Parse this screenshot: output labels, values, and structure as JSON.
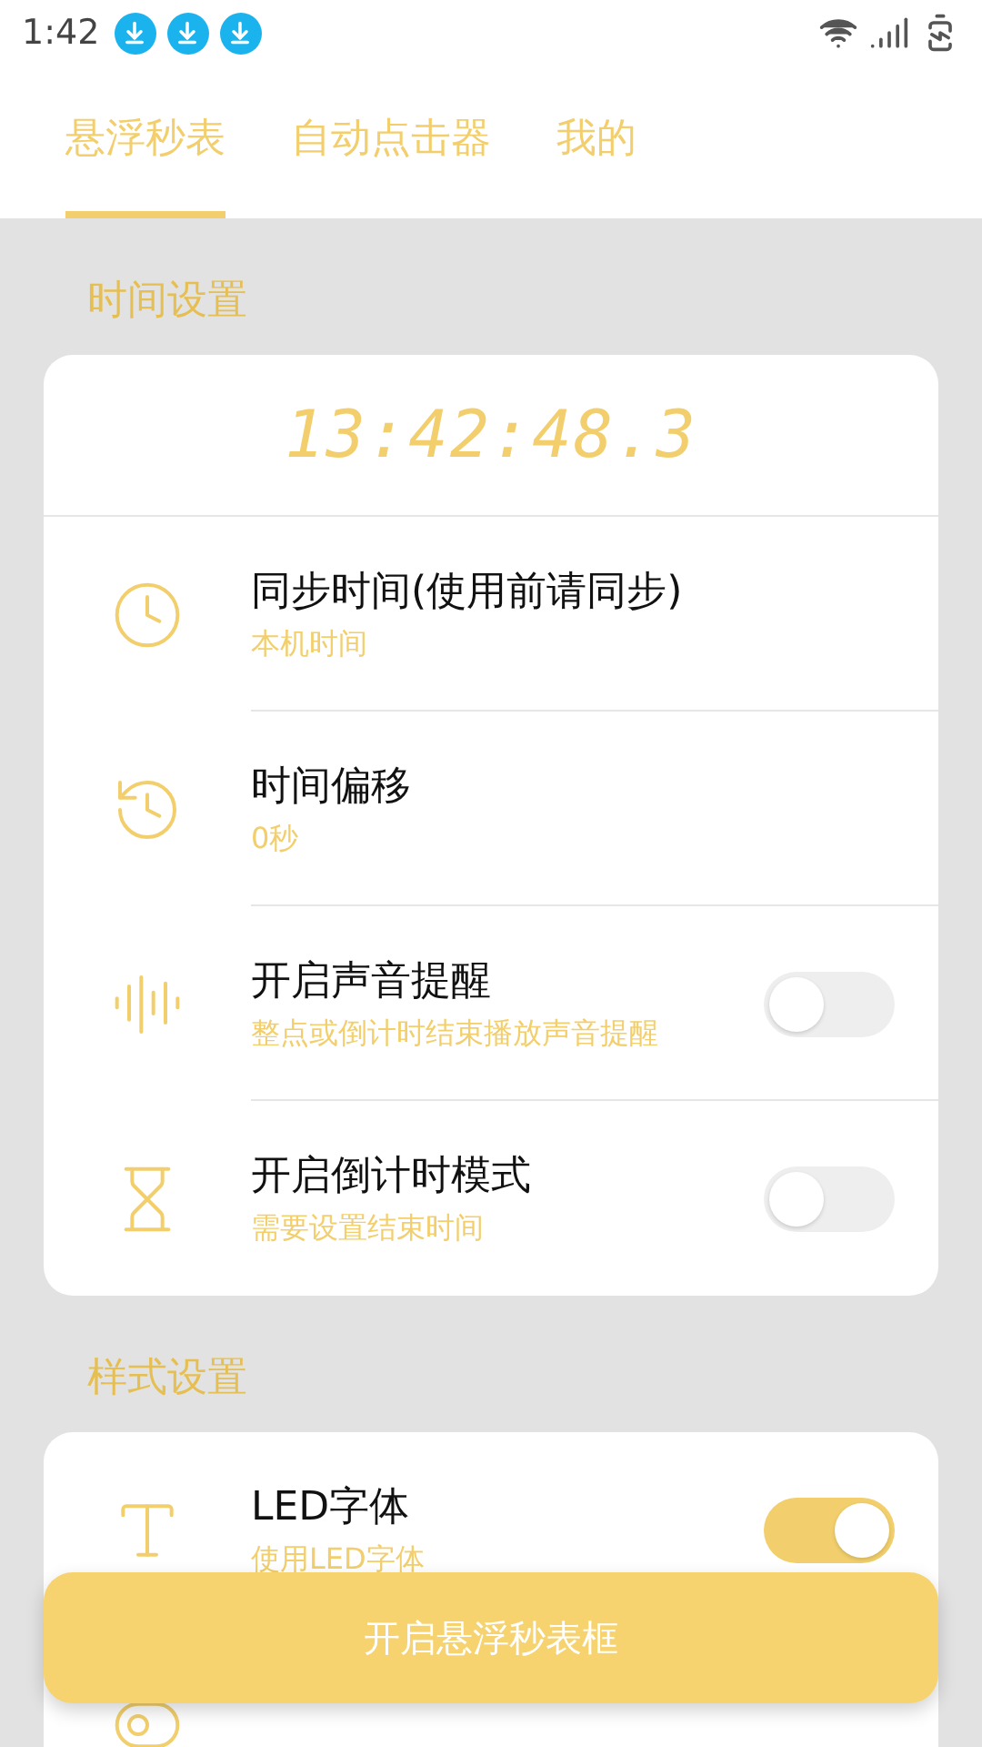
{
  "status_bar": {
    "time": "1:42"
  },
  "tabs": [
    {
      "label": "悬浮秒表",
      "selected": true
    },
    {
      "label": "自动点击器",
      "selected": false
    },
    {
      "label": "我的",
      "selected": false
    }
  ],
  "sections": [
    {
      "title": "时间设置",
      "clock": "13:42:48.3",
      "items": [
        {
          "kind": "nav",
          "title": "同步时间(使用前请同步)",
          "subtitle": "本机时间"
        },
        {
          "kind": "nav",
          "title": "时间偏移",
          "subtitle": "0秒"
        },
        {
          "kind": "toggle",
          "title": "开启声音提醒",
          "subtitle": "整点或倒计时结束播放声音提醒",
          "on": false
        },
        {
          "kind": "toggle",
          "title": "开启倒计时模式",
          "subtitle": "需要设置结束时间",
          "on": false
        }
      ]
    },
    {
      "title": "样式设置",
      "items": [
        {
          "kind": "toggle",
          "title": "LED字体",
          "subtitle": "使用LED字体",
          "on": true
        },
        {
          "kind": "nav"
        }
      ]
    }
  ],
  "floating_button": {
    "label": "开启悬浮秒表框"
  }
}
